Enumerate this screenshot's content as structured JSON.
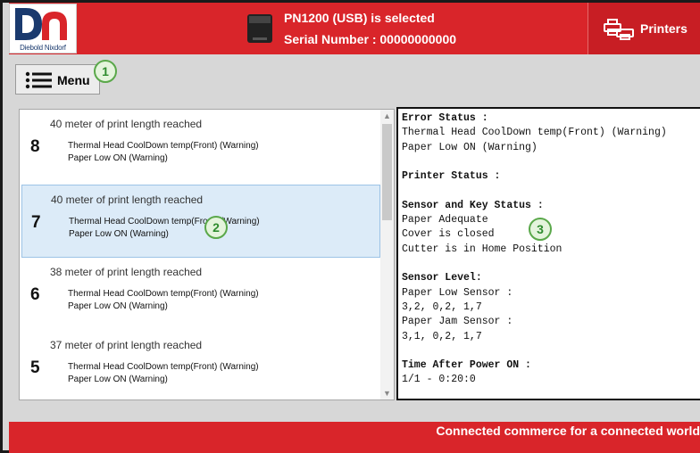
{
  "brand": {
    "name": "Diebold Nixdorf",
    "logo_letters": "DN",
    "primary_color": "#d9252a",
    "logo_color": "#1a3a6e"
  },
  "header": {
    "selected_line": "PN1200 (USB) is selected",
    "serial_line": "Serial Number : 00000000000",
    "printers_label": "Printers",
    "printers_icon": "printers-icon",
    "device_icon": "printer-device-icon"
  },
  "menu": {
    "label": "Menu",
    "icon": "hamburger-icon"
  },
  "callouts": [
    "1",
    "2",
    "3"
  ],
  "history": [
    {
      "number": "8",
      "title": "40 meter of print length reached",
      "lines": [
        "Thermal Head CoolDown temp(Front) (Warning)",
        "Paper Low ON (Warning)"
      ],
      "selected": false
    },
    {
      "number": "7",
      "title": "40 meter of print length reached",
      "lines": [
        "Thermal Head CoolDown temp(Front) (Warning)",
        "Paper Low ON (Warning)"
      ],
      "selected": true
    },
    {
      "number": "6",
      "title": "38 meter of print length reached",
      "lines": [
        "Thermal Head CoolDown temp(Front) (Warning)",
        "Paper Low ON (Warning)"
      ],
      "selected": false
    },
    {
      "number": "5",
      "title": "37 meter of print length reached",
      "lines": [
        "Thermal Head CoolDown temp(Front) (Warning)",
        "Paper Low ON (Warning)"
      ],
      "selected": false
    }
  ],
  "details": [
    {
      "text": "Error Status :",
      "bold": true
    },
    {
      "text": "Thermal Head CoolDown temp(Front) (Warning)",
      "bold": false
    },
    {
      "text": "Paper Low ON (Warning)",
      "bold": false
    },
    {
      "text": "",
      "bold": false
    },
    {
      "text": "Printer Status :",
      "bold": true
    },
    {
      "text": "",
      "bold": false
    },
    {
      "text": "Sensor and Key Status :",
      "bold": true
    },
    {
      "text": "Paper Adequate",
      "bold": false
    },
    {
      "text": "Cover is closed",
      "bold": false
    },
    {
      "text": "Cutter is in Home Position",
      "bold": false
    },
    {
      "text": "",
      "bold": false
    },
    {
      "text": "Sensor Level:",
      "bold": true
    },
    {
      "text": "Paper Low Sensor :",
      "bold": false
    },
    {
      "text": "3,2, 0,2, 1,7",
      "bold": false
    },
    {
      "text": "Paper Jam Sensor :",
      "bold": false
    },
    {
      "text": "3,1, 0,2, 1,7",
      "bold": false
    },
    {
      "text": "",
      "bold": false
    },
    {
      "text": "Time After Power ON :",
      "bold": true
    },
    {
      "text": "1/1 - 0:20:0",
      "bold": false
    }
  ],
  "footer": {
    "tagline": "Connected commerce for a connected world"
  }
}
